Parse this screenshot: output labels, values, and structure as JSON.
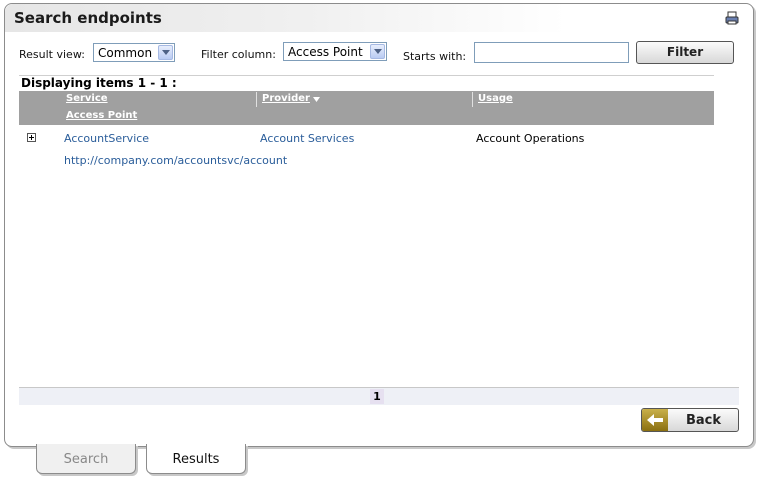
{
  "title": "Search endpoints",
  "filters": {
    "result_view_label": "Result view:",
    "result_view_value": "Common",
    "filter_column_label": "Filter column:",
    "filter_column_value": "Access Point",
    "starts_with_label": "Starts with:",
    "starts_with_value": "",
    "filter_button": "Filter"
  },
  "results": {
    "display_text": "Displaying items 1 - 1 :",
    "columns": {
      "service": "Service",
      "provider": "Provider",
      "provider_sort_icon": "sort-descending-icon",
      "usage": "Usage",
      "access_point": "Access Point"
    },
    "rows": [
      {
        "service": "AccountService",
        "provider": "Account Services",
        "usage": "Account Operations",
        "access_point": "http://company.com/accountsvc/account"
      }
    ]
  },
  "pager": {
    "current_page": "1"
  },
  "back_button": "Back",
  "tabs": [
    {
      "label": "Search",
      "active": false
    },
    {
      "label": "Results",
      "active": true
    }
  ],
  "colors": {
    "grid_header": "#a0a0a0",
    "link": "#2a5d9a",
    "back_arrow": "#a88a1e"
  }
}
